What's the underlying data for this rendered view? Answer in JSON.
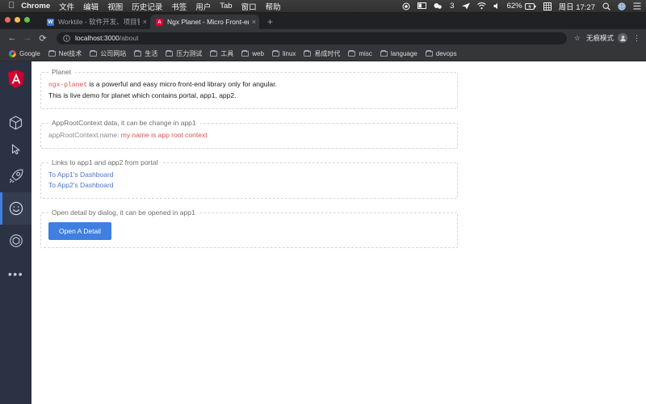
{
  "macbar": {
    "apple_icon": "apple-icon",
    "app_name": "Chrome",
    "menus": [
      "文件",
      "编辑",
      "视图",
      "历史记录",
      "书签",
      "用户",
      "Tab",
      "窗口",
      "帮助"
    ],
    "status": {
      "record_icon": "record-icon",
      "screen_icon": "display-icon",
      "cloud_icon": "dropbox-icon",
      "notif_count": "3",
      "telegram_icon": "telegram-icon",
      "wifi_icon": "wifi-icon",
      "volume_icon": "volume-icon",
      "battery_percent": "62%",
      "battery_icon": "battery-charging-icon",
      "keyboard_icon": "input-source-icon",
      "clock": "周日 17:27",
      "search_icon": "spotlight-search-icon",
      "globe_icon": "globe-icon",
      "menu_icon": "control-center-icon"
    }
  },
  "browser": {
    "window_controls": [
      "close",
      "minimize",
      "maximize"
    ],
    "tabs": [
      {
        "title": "Worktile - 软件开发、项目管理",
        "favicon": "worktile-favicon",
        "active": false,
        "close_label": "×"
      },
      {
        "title": "Ngx Planet - Micro Front-end l",
        "favicon": "angular-favicon",
        "active": true,
        "close_label": "×"
      }
    ],
    "new_tab_label": "+",
    "toolbar": {
      "back_label": "←",
      "forward_label": "→",
      "reload_label": "⟳",
      "site_info_icon": "info-circle-icon",
      "url_host": "localhost:3000",
      "url_path": "/about",
      "url_full": "localhost:3000/about",
      "star_label": "☆",
      "incognito_label": "无痕模式",
      "profile_icon": "incognito-avatar-icon",
      "menu_label": "⋮"
    },
    "bookmarks": [
      {
        "label": "Google",
        "icon": "google-icon"
      },
      {
        "label": "Net技术",
        "icon": "folder-icon"
      },
      {
        "label": "公司网站",
        "icon": "folder-icon"
      },
      {
        "label": "生活",
        "icon": "folder-icon"
      },
      {
        "label": "压力测试",
        "icon": "folder-icon"
      },
      {
        "label": "工具",
        "icon": "folder-icon"
      },
      {
        "label": "web",
        "icon": "folder-icon"
      },
      {
        "label": "linux",
        "icon": "folder-icon"
      },
      {
        "label": "易成时代",
        "icon": "folder-icon"
      },
      {
        "label": "misc",
        "icon": "folder-icon"
      },
      {
        "label": "language",
        "icon": "folder-icon"
      },
      {
        "label": "devops",
        "icon": "folder-icon"
      }
    ]
  },
  "app": {
    "sidebar": {
      "logo_icon": "angular-logo-icon",
      "items": [
        {
          "icon": "cube-icon",
          "active": false
        },
        {
          "icon": "cursor-pointer-icon",
          "active": false
        },
        {
          "icon": "rocket-icon",
          "active": false
        },
        {
          "icon": "smiley-face-icon",
          "active": true
        },
        {
          "icon": "hexagon-gear-icon",
          "active": false
        }
      ],
      "more_label": "•••"
    },
    "sections": [
      {
        "legend": "Planet",
        "code_text": "ngx-planet",
        "line1_rest": " is a powerful and easy micro front-end library only for angular.",
        "line2": "This is live demo for planet which contains portal, app1, app2."
      },
      {
        "legend": "AppRootContext data, it can be change in app1",
        "ctx_label": "appRootContext.name:",
        "ctx_value": "my name is app root context"
      },
      {
        "legend": "Links to app1 and app2 from portal",
        "links": [
          "To App1's Dashboard",
          "To App2's Dashboard"
        ]
      },
      {
        "legend": "Open detail by dialog, it can be opened in app1",
        "button_label": "Open A Detail"
      }
    ]
  },
  "colors": {
    "accent_blue": "#3f7fe0",
    "link_blue": "#4f76c8",
    "code_red": "#e05252",
    "sidebar_bg": "#2b3243",
    "chrome_dark": "#202124"
  }
}
